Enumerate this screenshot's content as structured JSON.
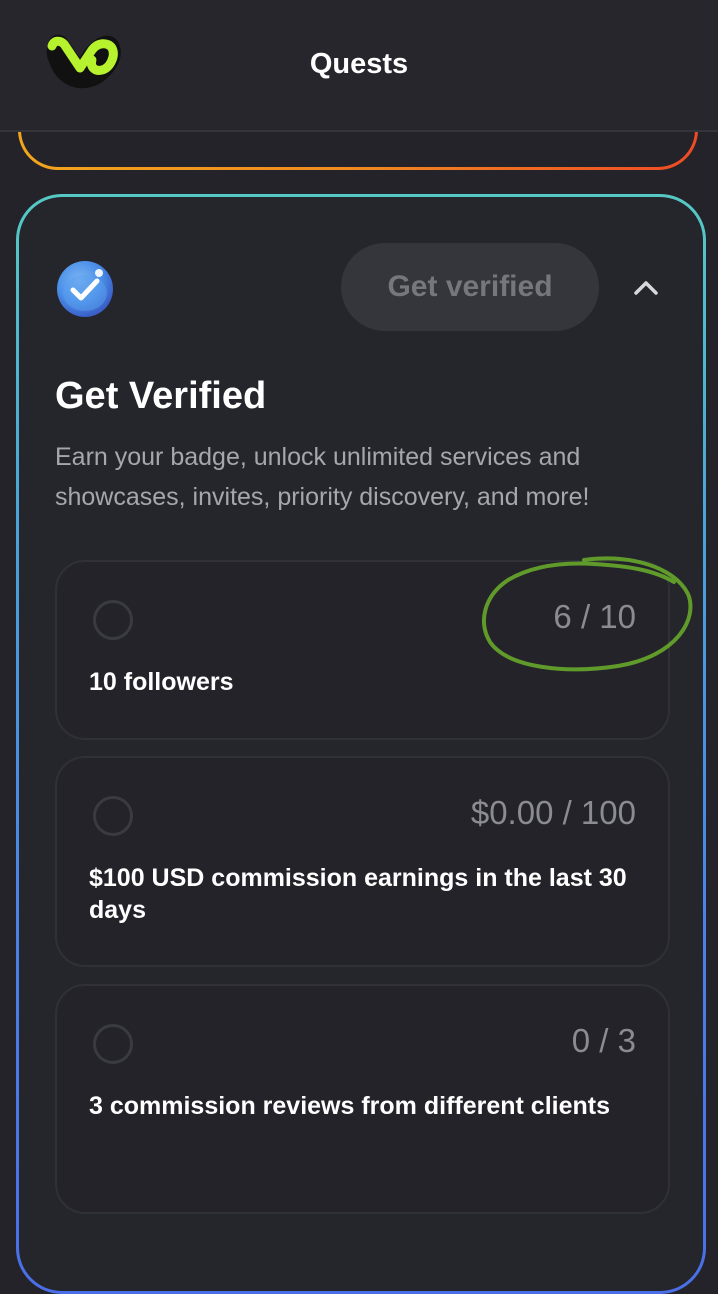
{
  "header": {
    "title": "Quests"
  },
  "card": {
    "button_label": "Get verified",
    "title": "Get Verified",
    "description": "Earn your badge, unlock unlimited services and showcases, invites, priority discovery, and more!",
    "quests": [
      {
        "progress": "6 / 10",
        "label": "10 followers"
      },
      {
        "progress": "$0.00 / 100",
        "label": "$100 USD commission earnings in the last 30 days"
      },
      {
        "progress": "0 / 3",
        "label": "3 commission reviews from different clients"
      }
    ]
  },
  "colors": {
    "accent_green": "#b6f22e",
    "annotation_green": "#5f9a2a",
    "badge_blue": "#4a8fe8",
    "border_top": "#56c9c4",
    "border_bottom": "#4a6fe8",
    "prev_card_orange": "#f08a20"
  }
}
